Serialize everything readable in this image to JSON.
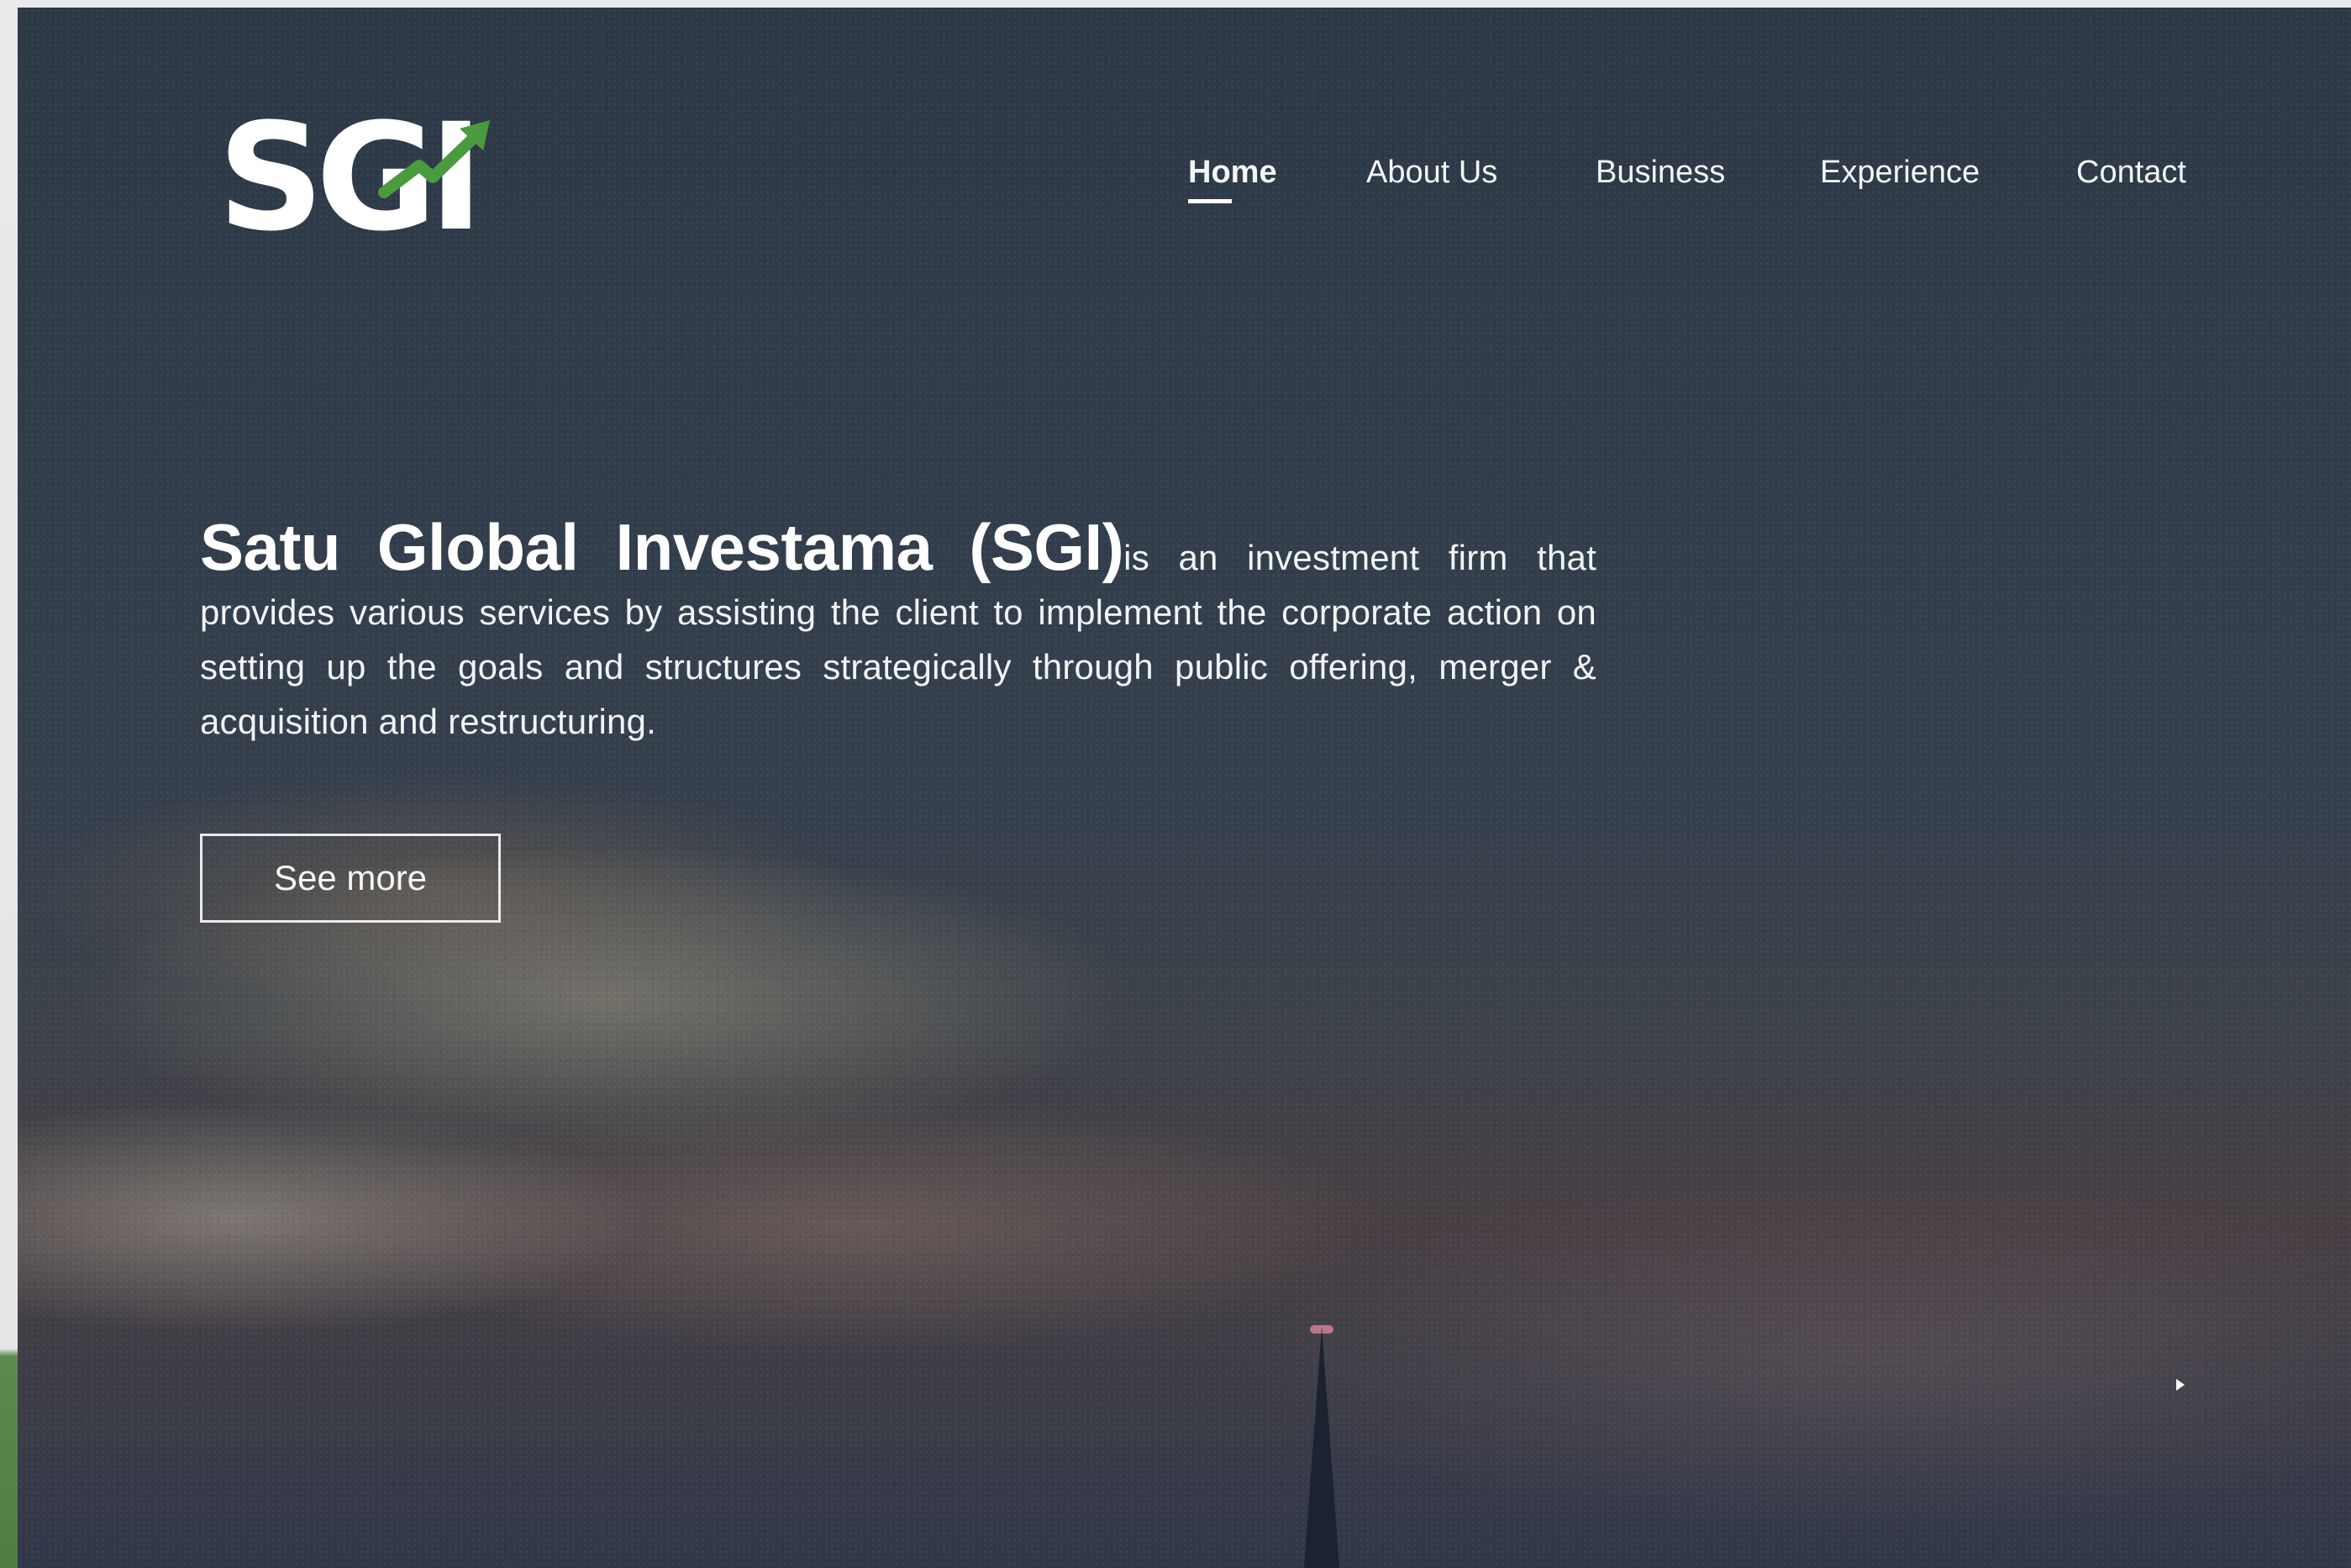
{
  "brand": {
    "logo_text": "SGI",
    "accent_color": "#4a9a3e"
  },
  "nav": {
    "items": [
      {
        "label": "Home",
        "active": true
      },
      {
        "label": "About Us",
        "active": false
      },
      {
        "label": "Business",
        "active": false
      },
      {
        "label": "Experience",
        "active": false
      },
      {
        "label": "Contact",
        "active": false
      }
    ]
  },
  "hero": {
    "title": "Satu Global Investama (SGI)",
    "description": "is an investment firm that provides various services by assisting the client to implement the corporate action on setting up the goals and structures strategically through public offering, merger & acquisition and restructuring.",
    "button_label": "See more"
  }
}
